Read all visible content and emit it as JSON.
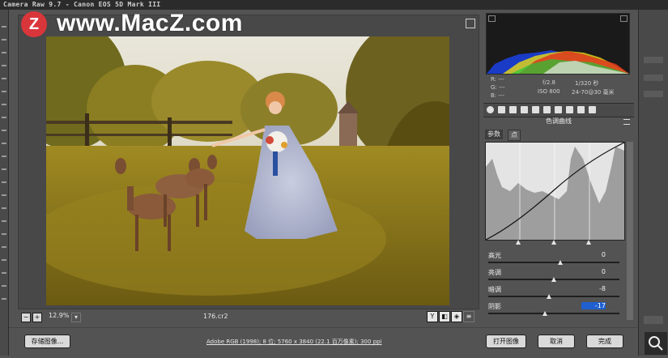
{
  "window": {
    "title": "Camera Raw 9.7 -  Canon EOS 5D Mark III"
  },
  "watermark": {
    "logo": "Z",
    "text": "www.MacZ.com"
  },
  "preview": {
    "zoom": "12.9%",
    "filename": "176.cr2"
  },
  "readout": {
    "r": "R:  ---",
    "g": "G:  ---",
    "b": "B:  ---",
    "aperture": "f/2.8",
    "shutter": "1/320 秒",
    "iso": "ISO 800",
    "lens": "24-70@30 毫米"
  },
  "panel": {
    "title": "色调曲线",
    "subtab_params": "参数",
    "subtab_point": "点"
  },
  "sliders": [
    {
      "label": "高光",
      "value": "0",
      "level": 0.55
    },
    {
      "label": "亮调",
      "value": "0",
      "level": 0.5
    },
    {
      "label": "暗调",
      "value": "-8",
      "level": 0.46
    },
    {
      "label": "阴影",
      "value": "-17",
      "level": 0.43
    }
  ],
  "bottom": {
    "save_label": "存储图像...",
    "workflow": "Adobe RGB (1998); 8 位; 5760 x 3840 (22.1 百万像素); 300 ppi",
    "open_label": "打开图像",
    "cancel_label": "取消",
    "done_label": "完成"
  },
  "colors": {
    "accent": "#d9363b",
    "panel": "#535353"
  },
  "icons": [
    "zoom-minus-icon",
    "zoom-plus-icon",
    "search-icon"
  ]
}
